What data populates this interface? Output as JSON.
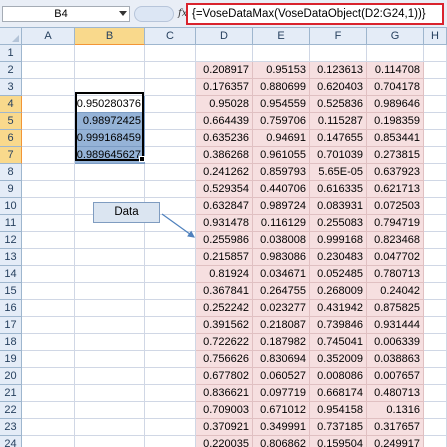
{
  "formula_bar": {
    "name_box": "B4",
    "fx_icon": "fx-icon",
    "formula": "{=VoseDataMax(VoseDataObject(D2:G24,1))}"
  },
  "columns": [
    "A",
    "B",
    "C",
    "D",
    "E",
    "F",
    "G",
    "H"
  ],
  "rows": [
    "1",
    "2",
    "3",
    "4",
    "5",
    "6",
    "7",
    "8",
    "9",
    "10",
    "11",
    "12",
    "13",
    "14",
    "15",
    "16",
    "17",
    "18",
    "19",
    "20",
    "21",
    "22",
    "23",
    "24"
  ],
  "selected": {
    "column": "B",
    "rows": [
      "4",
      "5",
      "6",
      "7"
    ]
  },
  "output_cells": [
    "0.950280376",
    "0.98972425",
    "0.999168459",
    "0.989645627"
  ],
  "data_table": [
    [
      "0.208917",
      "0.95153",
      "0.123613",
      "0.114708"
    ],
    [
      "0.176357",
      "0.880699",
      "0.620403",
      "0.704178"
    ],
    [
      "0.95028",
      "0.954559",
      "0.525836",
      "0.989646"
    ],
    [
      "0.664439",
      "0.759706",
      "0.115287",
      "0.198359"
    ],
    [
      "0.635236",
      "0.94691",
      "0.147655",
      "0.853441"
    ],
    [
      "0.386268",
      "0.961055",
      "0.701039",
      "0.273815"
    ],
    [
      "0.241262",
      "0.859793",
      "5.65E-05",
      "0.637923"
    ],
    [
      "0.529354",
      "0.440706",
      "0.616335",
      "0.621713"
    ],
    [
      "0.632847",
      "0.989724",
      "0.083931",
      "0.072503"
    ],
    [
      "0.931478",
      "0.116129",
      "0.255083",
      "0.794719"
    ],
    [
      "0.255986",
      "0.038008",
      "0.999168",
      "0.823468"
    ],
    [
      "0.215857",
      "0.983086",
      "0.230483",
      "0.047702"
    ],
    [
      "0.81924",
      "0.034671",
      "0.052485",
      "0.780713"
    ],
    [
      "0.367841",
      "0.264755",
      "0.268009",
      "0.24042"
    ],
    [
      "0.252242",
      "0.023277",
      "0.431942",
      "0.875825"
    ],
    [
      "0.391562",
      "0.218087",
      "0.739846",
      "0.931444"
    ],
    [
      "0.722622",
      "0.187982",
      "0.745041",
      "0.006339"
    ],
    [
      "0.756626",
      "0.830694",
      "0.352009",
      "0.038863"
    ],
    [
      "0.677802",
      "0.060527",
      "0.008086",
      "0.007657"
    ],
    [
      "0.836621",
      "0.097719",
      "0.668174",
      "0.480713"
    ],
    [
      "0.709003",
      "0.671012",
      "0.954158",
      "0.1316"
    ],
    [
      "0.370921",
      "0.349991",
      "0.737185",
      "0.317657"
    ],
    [
      "0.220035",
      "0.806862",
      "0.159504",
      "0.249917"
    ]
  ],
  "callout": {
    "label": "Data"
  },
  "colors": {
    "data_fill": "#f6dfe0",
    "output_fill": "#95b3d7",
    "formula_border": "#d9232d",
    "header_selected": "#f9d98c"
  }
}
